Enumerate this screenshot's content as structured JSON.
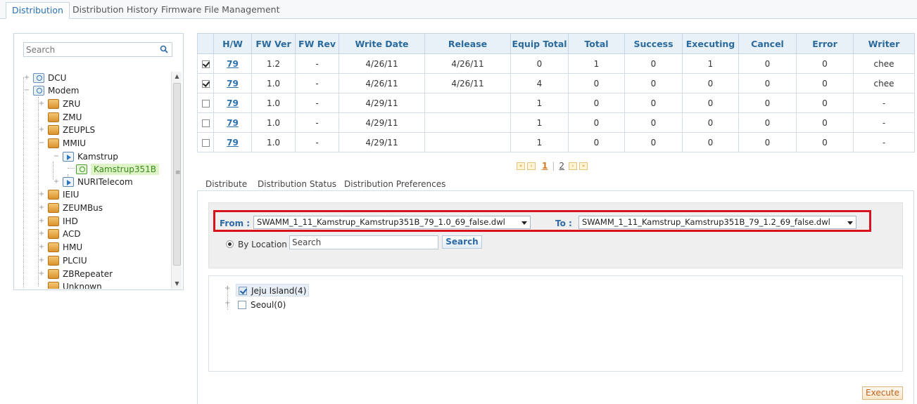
{
  "top_tabs": [
    "Distribution",
    "Distribution History",
    "Firmware File Management"
  ],
  "tree": {
    "search_placeholder": "Search",
    "items": [
      {
        "label": "DCU",
        "icon": "network-node-icon"
      },
      {
        "label": "Modem",
        "icon": "network-node-icon"
      },
      {
        "label": "ZRU",
        "icon": "folder-icon"
      },
      {
        "label": "ZMU",
        "icon": "folder-icon"
      },
      {
        "label": "ZEUPLS",
        "icon": "folder-icon"
      },
      {
        "label": "MMIU",
        "icon": "folder-icon"
      },
      {
        "label": "Kamstrup",
        "icon": "device-icon"
      },
      {
        "label": "Kamstrup351B",
        "icon": "green-node-icon",
        "selected": true
      },
      {
        "label": "NURITelecom",
        "icon": "device-icon"
      },
      {
        "label": "IEIU",
        "icon": "folder-icon"
      },
      {
        "label": "ZEUMBus",
        "icon": "folder-icon"
      },
      {
        "label": "IHD",
        "icon": "folder-icon"
      },
      {
        "label": "ACD",
        "icon": "folder-icon"
      },
      {
        "label": "HMU",
        "icon": "folder-icon"
      },
      {
        "label": "PLCIU",
        "icon": "folder-icon"
      },
      {
        "label": "ZBRepeater",
        "icon": "folder-icon"
      },
      {
        "label": "Unknown",
        "icon": "folder-icon"
      }
    ]
  },
  "grid": {
    "columns": [
      "H/W",
      "FW Ver",
      "FW Rev",
      "Write Date",
      "Release",
      "Equip Total",
      "Total",
      "Success",
      "Executing",
      "Cancel",
      "Error",
      "Writer"
    ],
    "rows": [
      {
        "checked": true,
        "hw": "79",
        "fw_ver": "1.2",
        "fw_rev": "-",
        "write_date": "4/26/11",
        "release": "4/26/11",
        "equip_total": "0",
        "total": "1",
        "success": "0",
        "executing": "1",
        "cancel": "0",
        "error": "0",
        "writer": "chee"
      },
      {
        "checked": true,
        "hw": "79",
        "fw_ver": "1.0",
        "fw_rev": "-",
        "write_date": "4/26/11",
        "release": "4/26/11",
        "equip_total": "4",
        "total": "0",
        "success": "0",
        "executing": "0",
        "cancel": "0",
        "error": "0",
        "writer": "chee"
      },
      {
        "checked": false,
        "hw": "79",
        "fw_ver": "1.0",
        "fw_rev": "-",
        "write_date": "4/29/11",
        "release": "",
        "equip_total": "1",
        "total": "0",
        "success": "0",
        "executing": "0",
        "cancel": "0",
        "error": "0",
        "writer": "-"
      },
      {
        "checked": false,
        "hw": "79",
        "fw_ver": "1.0",
        "fw_rev": "-",
        "write_date": "4/29/11",
        "release": "",
        "equip_total": "1",
        "total": "0",
        "success": "0",
        "executing": "0",
        "cancel": "0",
        "error": "0",
        "writer": "-"
      },
      {
        "checked": false,
        "hw": "79",
        "fw_ver": "1.0",
        "fw_rev": "-",
        "write_date": "4/29/11",
        "release": "",
        "equip_total": "1",
        "total": "0",
        "success": "0",
        "executing": "0",
        "cancel": "0",
        "error": "0",
        "writer": "-"
      }
    ]
  },
  "pager": {
    "current": "1",
    "other": "2",
    "separator": "|"
  },
  "sub_tabs": [
    "Distribute",
    "Distribution Status",
    "Distribution Preferences"
  ],
  "distribute": {
    "from_label": "From :",
    "from_value": "SWAMM_1_11_Kamstrup_Kamstrup351B_79_1.0_69_false.dwl",
    "to_label": "To :",
    "to_value": "SWAMM_1_11_Kamstrup_Kamstrup351B_79_1.2_69_false.dwl",
    "by_location_label": "By Location",
    "location_search_value": "Search",
    "search_button": "Search",
    "locations": [
      {
        "label": "Jeju Island(4)",
        "checked": true
      },
      {
        "label": "Seoul(0)",
        "checked": false
      }
    ],
    "execute_button": "Execute"
  },
  "colors": {
    "accent": "#2a72b5",
    "highlight_border": "#d9131e",
    "header_bg": "#e8f1f8"
  }
}
